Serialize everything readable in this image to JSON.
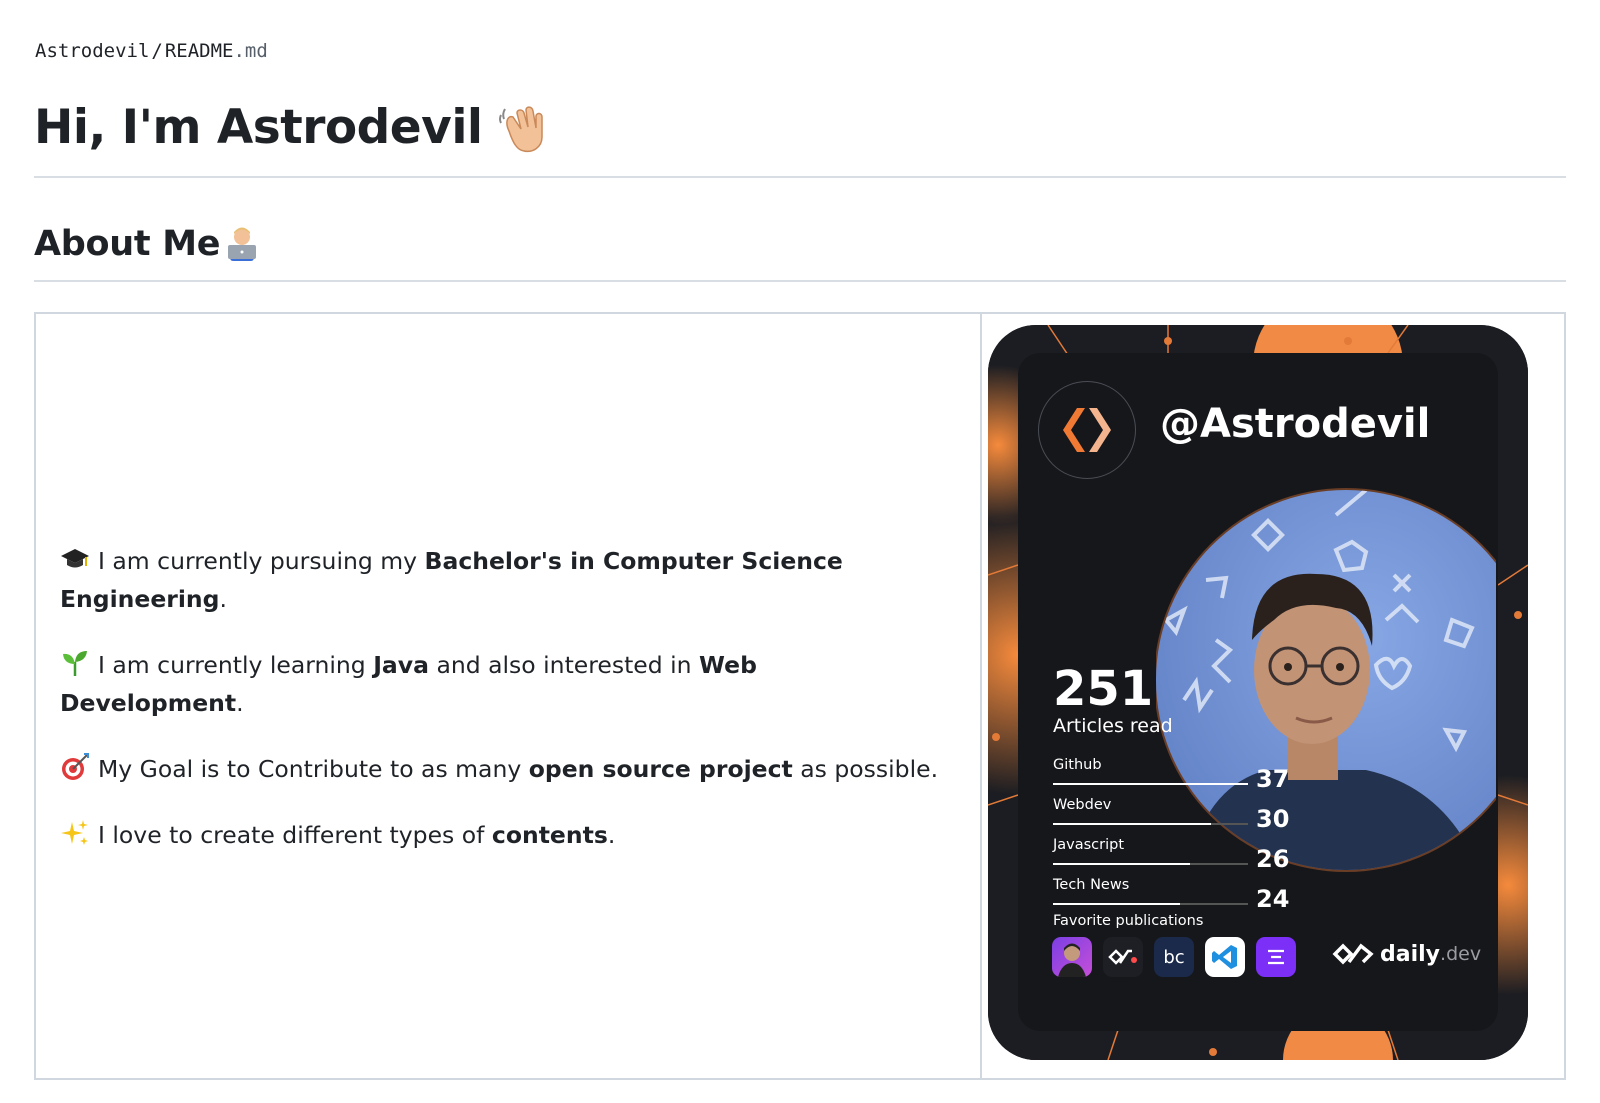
{
  "breadcrumb": {
    "owner": "Astrodevil",
    "separator": "/",
    "file_base": "README",
    "file_ext": ".md"
  },
  "heading": {
    "title": "Hi, I'm Astrodevil",
    "emoji_icon": "waving-hand-icon"
  },
  "about": {
    "title": "About Me",
    "emoji_icon": "technologist-icon",
    "items": [
      {
        "icon": "graduation-cap-icon",
        "pre": "I am currently pursuing my ",
        "bold1": "Bachelor's in Computer Science Engineering",
        "post": "."
      },
      {
        "icon": "seedling-icon",
        "pre": "I am currently learning ",
        "bold1": "Java",
        "mid": " and also interested in ",
        "bold2": "Web Development",
        "post": "."
      },
      {
        "icon": "direct-hit-icon",
        "pre": "My Goal is to Contribute to as many ",
        "bold1": "open source project",
        "post": " as possible."
      },
      {
        "icon": "sparkles-icon",
        "pre": "I love to create different types of ",
        "bold1": "contents",
        "post": "."
      }
    ]
  },
  "card": {
    "handle": "@Astrodevil",
    "articles_count": "251",
    "articles_label": "Articles read",
    "tags": [
      {
        "name": "Github",
        "count": "37",
        "fill": 1.0
      },
      {
        "name": "Webdev",
        "count": "30",
        "fill": 0.81
      },
      {
        "name": "Javascript",
        "count": "26",
        "fill": 0.7
      },
      {
        "name": "Tech News",
        "count": "24",
        "fill": 0.65
      }
    ],
    "favorites_label": "Favorite publications",
    "publications": [
      {
        "icon": "avatar-publication-icon",
        "color": "#7b3fe4",
        "text": ""
      },
      {
        "icon": "daily-dev-publication-icon",
        "color": "#1d1f25",
        "text": ""
      },
      {
        "icon": "bc-publication-icon",
        "color": "#1b2a4a",
        "text": "bc"
      },
      {
        "icon": "vscode-publication-icon",
        "color": "#ffffff",
        "text": ""
      },
      {
        "icon": "purple-publication-icon",
        "color": "#7b2ff7",
        "text": ""
      }
    ],
    "brand_main": "daily",
    "brand_sub": ".dev",
    "accent": "#f07a34"
  }
}
